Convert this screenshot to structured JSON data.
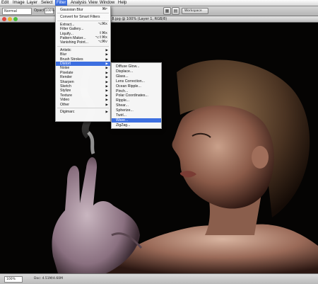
{
  "menubar": {
    "items": [
      "Edit",
      "Image",
      "Layer",
      "Select",
      "Filter",
      "Analysis",
      "View",
      "Window",
      "Help"
    ],
    "active": "Filter"
  },
  "options": {
    "mode": "Normal",
    "opacity_label": "Opacity:",
    "opacity_value": "100%",
    "workspace": "Workspace"
  },
  "document": {
    "title": "DSC_9377_8.jpg @ 100% (Layer 1, RGB/8)",
    "zoom": "100%",
    "doc_size": "Doc: 4.51M/4.60M"
  },
  "filter_menu": {
    "items": [
      {
        "label": "Gaussian Blur",
        "shortcut": "⌘F"
      },
      {
        "sep": true
      },
      {
        "label": "Convert for Smart Filters"
      },
      {
        "sep": true
      },
      {
        "label": "Extract...",
        "shortcut": "⌥⌘X"
      },
      {
        "label": "Filter Gallery..."
      },
      {
        "label": "Liquify...",
        "shortcut": "⇧⌘X"
      },
      {
        "label": "Pattern Maker...",
        "shortcut": "⌥⇧⌘X"
      },
      {
        "label": "Vanishing Point...",
        "shortcut": "⌥⌘V"
      },
      {
        "sep": true
      },
      {
        "label": "Artistic",
        "submenu": true
      },
      {
        "label": "Blur",
        "submenu": true
      },
      {
        "label": "Brush Strokes",
        "submenu": true
      },
      {
        "label": "Distort",
        "submenu": true,
        "highlighted": true
      },
      {
        "label": "Noise",
        "submenu": true
      },
      {
        "label": "Pixelate",
        "submenu": true
      },
      {
        "label": "Render",
        "submenu": true
      },
      {
        "label": "Sharpen",
        "submenu": true
      },
      {
        "label": "Sketch",
        "submenu": true
      },
      {
        "label": "Stylize",
        "submenu": true
      },
      {
        "label": "Texture",
        "submenu": true
      },
      {
        "label": "Video",
        "submenu": true
      },
      {
        "label": "Other",
        "submenu": true
      },
      {
        "sep": true
      },
      {
        "label": "Digimarc",
        "submenu": true
      }
    ]
  },
  "distort_menu": {
    "items": [
      {
        "label": "Diffuse Glow..."
      },
      {
        "label": "Displace..."
      },
      {
        "label": "Glass..."
      },
      {
        "label": "Lens Correction..."
      },
      {
        "label": "Ocean Ripple..."
      },
      {
        "label": "Pinch..."
      },
      {
        "label": "Polar Coordinates..."
      },
      {
        "label": "Ripple..."
      },
      {
        "label": "Shear..."
      },
      {
        "label": "Spherize..."
      },
      {
        "label": "Twirl..."
      },
      {
        "label": "Wave...",
        "highlighted": true
      },
      {
        "label": "ZigZag..."
      }
    ]
  },
  "colors": {
    "highlight": "#3d6fe0",
    "canvas_bg": "#050403"
  }
}
